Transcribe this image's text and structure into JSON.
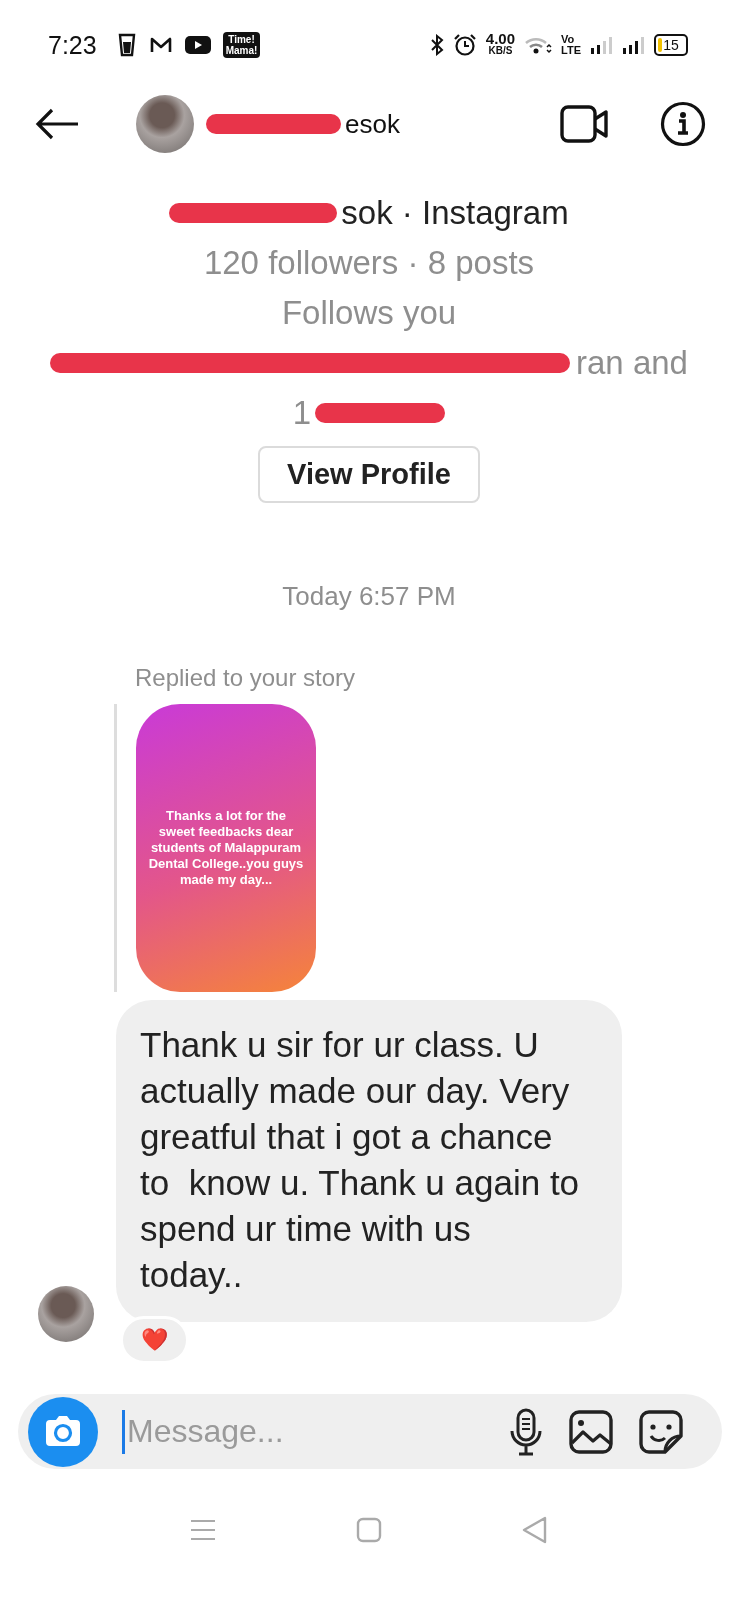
{
  "status_bar": {
    "time": "7:23",
    "app_badge": [
      "Time!",
      "Mama!"
    ],
    "speed": "4.00",
    "speed_unit": "KB/S",
    "volte": [
      "Vo",
      "LTE"
    ],
    "battery": "15"
  },
  "header": {
    "name_visible": "esok"
  },
  "profile": {
    "name_visible": "sok · Instagram",
    "stats": "120 followers · 8 posts",
    "follows": "Follows you",
    "mutual_visible": "ran and",
    "mutual_visible_2": "1",
    "button": "View Profile"
  },
  "timestamp": "Today 6:57 PM",
  "reply_label": "Replied to your story",
  "story": {
    "text": "Thanks a lot for the sweet feedbacks dear students of Malappuram Dental College..you guys made my day..."
  },
  "message": {
    "text": "Thank u sir for ur class. U actually made our day. Very greatful that i got a chance to  know u. Thank u again to spend ur time with us today..",
    "reaction": "❤️"
  },
  "composer": {
    "placeholder": "Message..."
  },
  "nav": [
    {
      "kind": "menu"
    },
    {
      "kind": "home"
    },
    {
      "kind": "back"
    }
  ]
}
